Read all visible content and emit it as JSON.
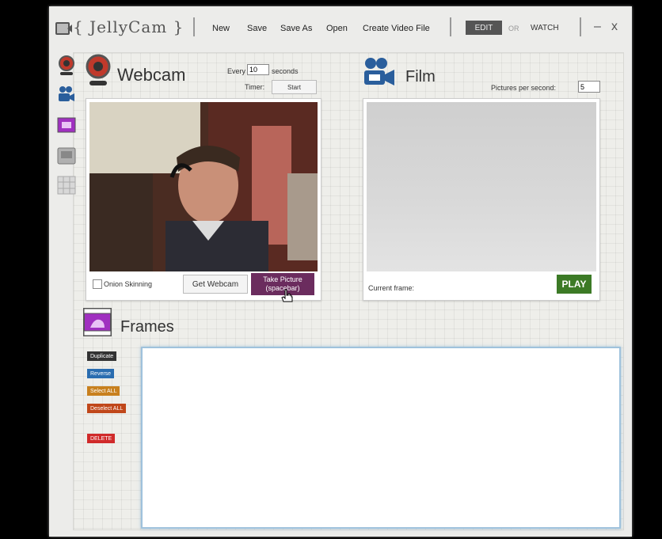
{
  "app": {
    "title": "{ JellyCam }"
  },
  "menu": {
    "new": "New",
    "save": "Save",
    "save_as": "Save As",
    "open": "Open",
    "create_video": "Create Video File"
  },
  "mode": {
    "edit": "EDIT",
    "or": "OR",
    "watch": "WATCH"
  },
  "window": {
    "minimize": "–",
    "close": "x"
  },
  "webcam": {
    "title": "Webcam",
    "every_label": "Every",
    "every_value": "10",
    "seconds_label": "seconds",
    "timer_label": "Timer:",
    "start_label": "Start",
    "onion_label": "Onion Skinning",
    "get_webcam_label": "Get Webcam",
    "take_picture_label": "Take Picture",
    "take_picture_sub": "(spacebar)"
  },
  "film": {
    "title": "Film",
    "pps_label": "Pictures per second:",
    "pps_value": "5",
    "current_frame_label": "Current frame:",
    "play_label": "PLAY"
  },
  "frames": {
    "title": "Frames",
    "buttons": [
      "Duplicate",
      "Reverse",
      "Select ALL",
      "Deselect ALL",
      "DELETE"
    ]
  },
  "colors": {
    "take_picture": "#6b2c5e",
    "play": "#3c7a26",
    "frames_icon": "#a030c0",
    "duplicate": "#333333",
    "reverse": "#2a6db0",
    "select_all": "#c8801e",
    "deselect_all": "#c0471a",
    "delete": "#d02a2a"
  }
}
